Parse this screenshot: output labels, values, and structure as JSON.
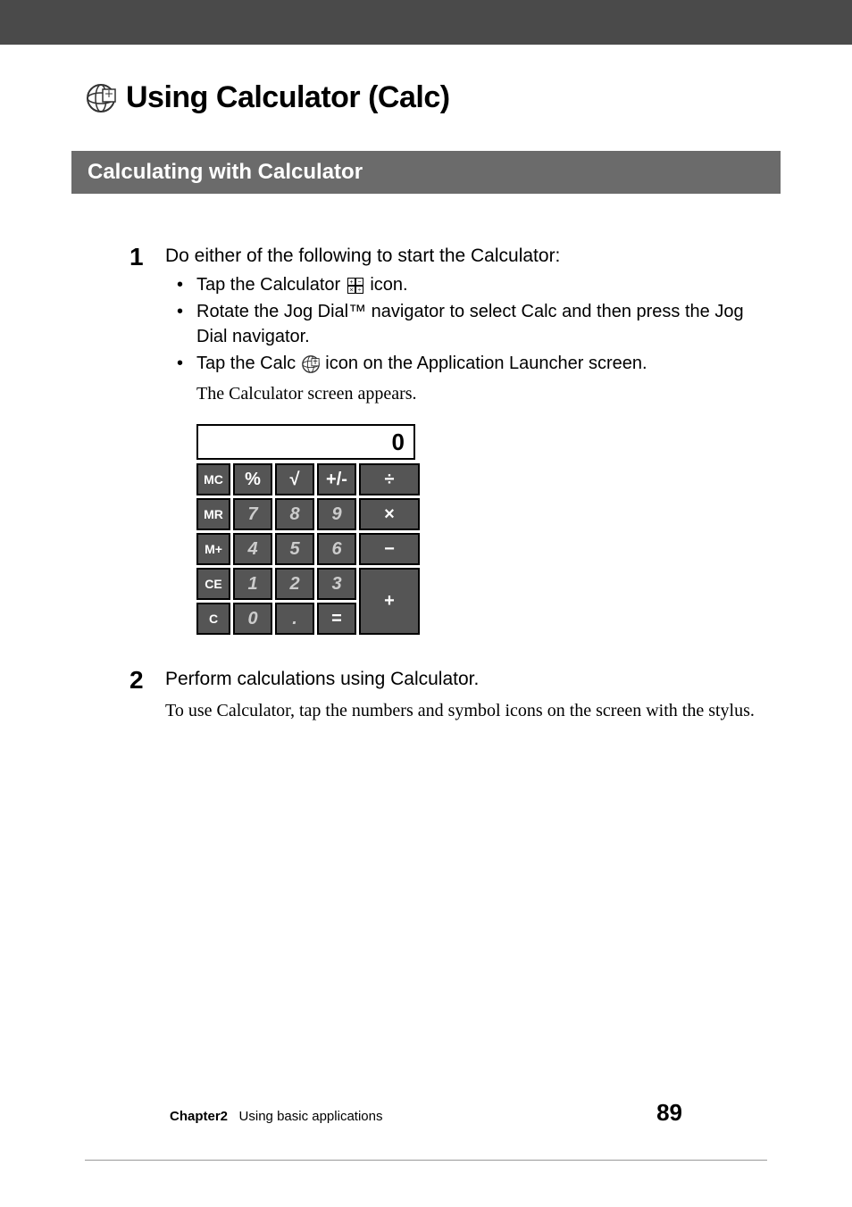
{
  "page_title": "Using Calculator (Calc)",
  "section_heading": "Calculating with Calculator",
  "steps": [
    {
      "num": "1",
      "heading": "Do either of the following to start the Calculator:",
      "bullets": [
        {
          "pre": "Tap the Calculator ",
          "post": " icon.",
          "icon": "calc-small"
        },
        {
          "text": "Rotate the Jog Dial™ navigator to select Calc and then press the Jog Dial navigator."
        },
        {
          "pre": "Tap the Calc ",
          "post": " icon on the Application Launcher screen.",
          "icon": "calc-globe"
        }
      ],
      "result": "The Calculator screen appears."
    },
    {
      "num": "2",
      "heading": "Perform calculations using Calculator.",
      "body": "To use Calculator, tap the numbers and symbol icons on the screen with the stylus."
    }
  ],
  "calc": {
    "display": "0",
    "grid": [
      [
        "MC",
        "%",
        "√",
        "+/-",
        "÷"
      ],
      [
        "MR",
        "7",
        "8",
        "9",
        "×"
      ],
      [
        "M+",
        "4",
        "5",
        "6",
        "−"
      ],
      [
        "CE",
        "1",
        "2",
        "3",
        "+"
      ],
      [
        "C",
        "0",
        ".",
        "=",
        ""
      ]
    ]
  },
  "footer": {
    "chapter_label": "Chapter2",
    "chapter_text": "Using basic applications",
    "page_number": "89"
  },
  "chart_data": null
}
